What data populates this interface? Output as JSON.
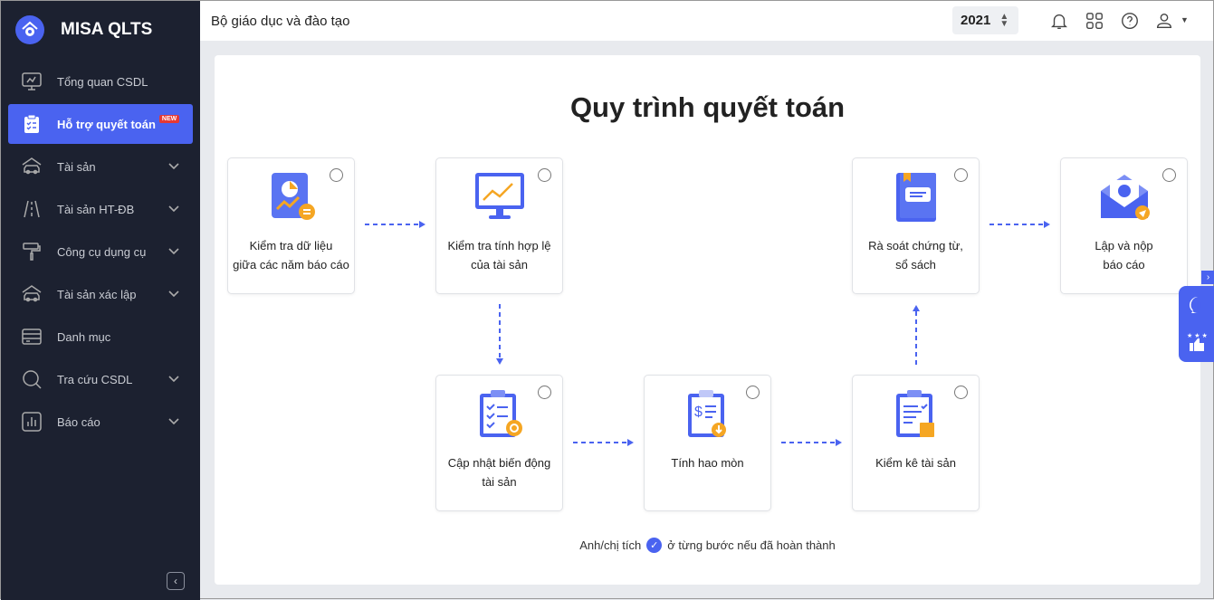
{
  "app": {
    "name": "MISA QLTS"
  },
  "sidebar": {
    "items": [
      {
        "label": "Tổng quan CSDL"
      },
      {
        "label": "Hỗ trợ quyết toán",
        "badge": "NEW",
        "active": true
      },
      {
        "label": "Tài sản"
      },
      {
        "label": "Tài sản HT-ĐB"
      },
      {
        "label": "Công cụ dụng cụ"
      },
      {
        "label": "Tài sản xác lập"
      },
      {
        "label": "Danh mục"
      },
      {
        "label": "Tra cứu CSDL"
      },
      {
        "label": "Báo cáo"
      }
    ]
  },
  "header": {
    "title": "Bộ giáo dục và đào tạo",
    "year": "2021"
  },
  "main": {
    "title": "Quy trình quyết toán",
    "steps": [
      {
        "line1": "Kiểm tra dữ liệu",
        "line2": "giữa các năm báo cáo"
      },
      {
        "line1": "Kiểm tra tính hợp lệ",
        "line2": "của tài sản"
      },
      {
        "line1": "Rà soát chứng từ,",
        "line2": "sổ sách"
      },
      {
        "line1": "Lập và nộp",
        "line2": "báo cáo"
      },
      {
        "line1": "Cập nhật biến động",
        "line2": "tài sản"
      },
      {
        "line1": "Tính hao mòn",
        "line2": ""
      },
      {
        "line1": "Kiểm kê tài sản",
        "line2": ""
      }
    ],
    "note_before": "Anh/chị tích",
    "note_after": "ở từng bước nếu đã hoàn thành"
  },
  "colors": {
    "accent": "#4a63f0",
    "sidebar": "#1c2130"
  }
}
